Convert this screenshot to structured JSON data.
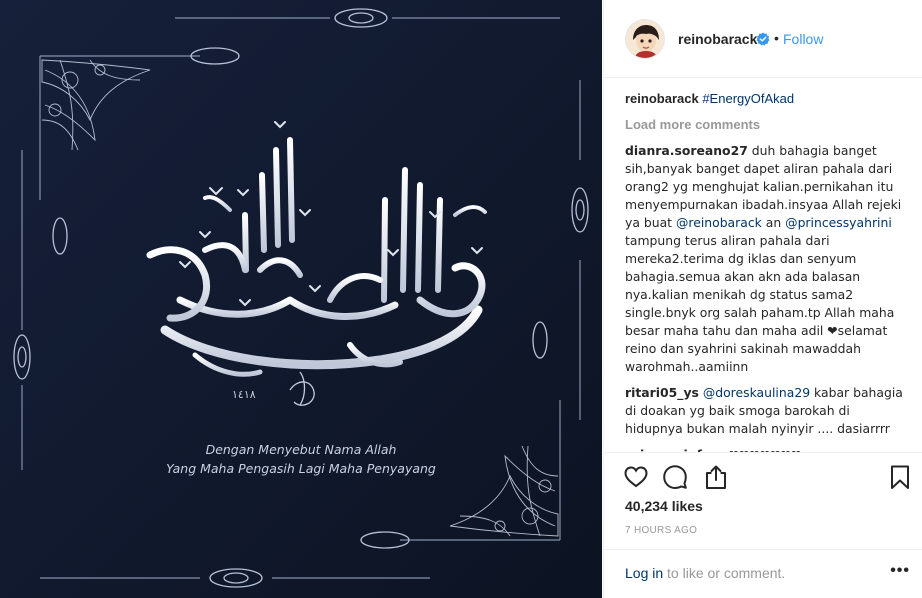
{
  "post": {
    "image": {
      "calligraphy_glyph": "بسم الله الرحمن الرحيم",
      "year_mark": "١٤١٨",
      "caption_lines": [
        "Dengan Menyebut Nama Allah",
        "Yang Maha Pengasih Lagi Maha Penyayang"
      ]
    },
    "header": {
      "username": "reinobarack",
      "separator": "•",
      "follow_label": "Follow"
    },
    "caption": {
      "username": "reinobarack",
      "hashtag": "#EnergyOfAkad"
    },
    "load_more_label": "Load more comments",
    "comments": [
      {
        "username": "dianra.soreano27",
        "text_a": " duh bahagia banget sih,banyak banget dapet aliran pahala dari orang2 yg menghujat kalian.pernikahan itu menyempurnakan ibadah.insyaa Allah rejeki ya buat ",
        "mention_a": "@reinobarack",
        "text_b": " an ",
        "mention_b": "@princessyahrini",
        "text_c": " tampung terus aliran pahala dari mereka2.terima dg iklas dan senyum bahagia.semua akan akn ada balasan nya.kalian menikah dg status sama2 single.bnyk org salah paham.tp Allah maha besar maha tahu dan maha adil ❤selamat reino dan syahrini sakinah mawaddah warohmah..aamiinn"
      },
      {
        "username": "ritari05_ys",
        "mention": "@doreskaulina29",
        "text": " kabar bahagia di doakan yg baik smoga barokah di hidupnya bukan malah nyinyir .... dasiarrrr"
      },
      {
        "username": "princessjufrye",
        "text": " ❤❤❤❤❤❤❤"
      }
    ],
    "likes": "40,234 likes",
    "time": "7 HOURS AGO",
    "footer": {
      "login_link": "Log in",
      "login_rest": " to like or comment.",
      "more": "•••"
    }
  },
  "colors": {
    "image_background": "#111a2b",
    "link": "#003569",
    "follow": "#3897f0",
    "muted": "#999999"
  }
}
